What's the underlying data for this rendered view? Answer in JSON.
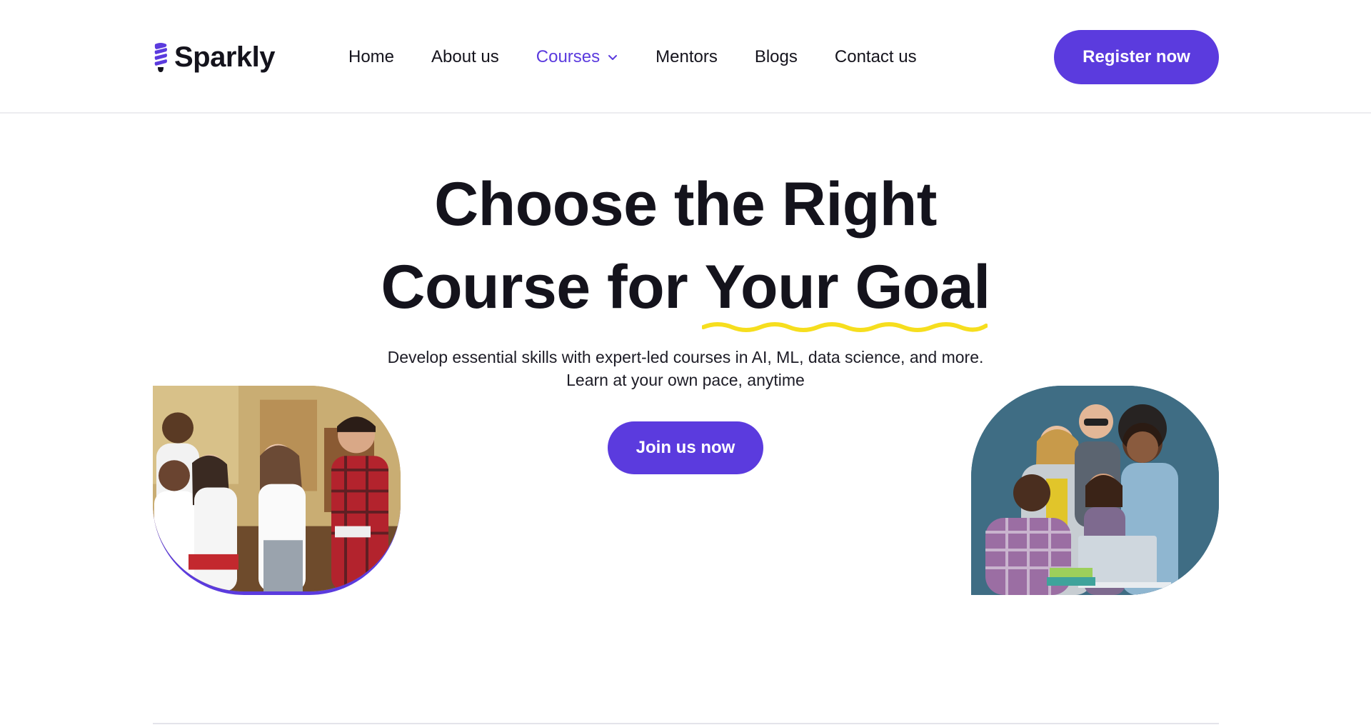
{
  "brand": {
    "name": "Sparkly",
    "accent": "#5b3bde",
    "highlight": "#f6de1e",
    "logo_icon": "lightbulb-icon"
  },
  "nav": {
    "items": [
      {
        "label": "Home",
        "active": false
      },
      {
        "label": "About us",
        "active": false
      },
      {
        "label": "Courses",
        "active": true,
        "has_dropdown": true
      },
      {
        "label": "Mentors",
        "active": false
      },
      {
        "label": "Blogs",
        "active": false
      },
      {
        "label": "Contact us",
        "active": false
      }
    ],
    "register_label": "Register now"
  },
  "hero": {
    "title_line1": "Choose the Right",
    "title_line2_prefix": "Course for ",
    "title_highlight": "Your Goal",
    "subtitle": "Develop essential skills with expert-led courses in AI, ML, data science, and more. Learn at your own pace, anytime",
    "cta_label": "Join us now"
  },
  "images": [
    {
      "name": "students-group-photo"
    },
    {
      "name": "team-laptop-photo"
    }
  ]
}
